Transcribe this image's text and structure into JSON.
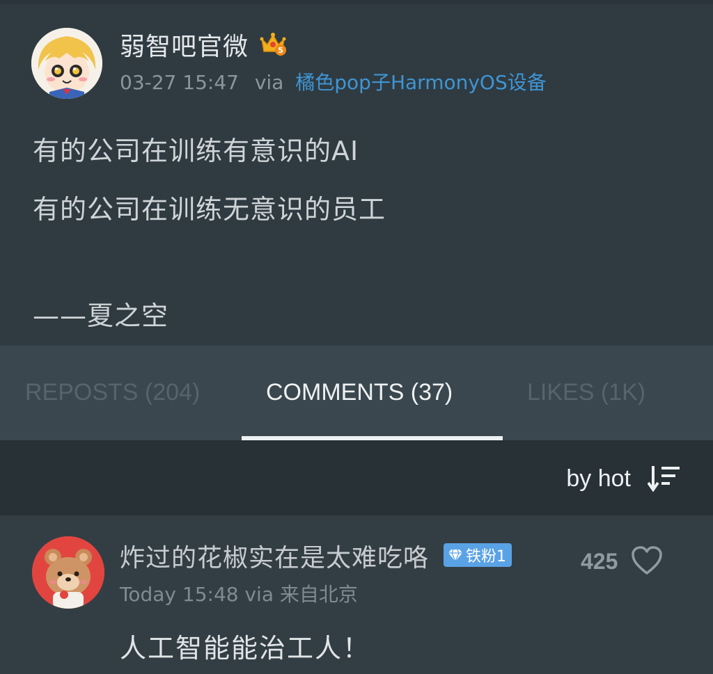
{
  "post": {
    "author": "弱智吧官微",
    "time": "03-27 15:47",
    "via": "via",
    "device": "橘色pop子HarmonyOS设备",
    "lines": [
      "有的公司在训练有意识的AI",
      "有的公司在训练无意识的员工",
      "——夏之空"
    ]
  },
  "tabs": [
    {
      "label": "REPOSTS (204)",
      "active": false
    },
    {
      "label": "COMMENTS (37)",
      "active": true
    },
    {
      "label": "LIKES (1K)",
      "active": false
    }
  ],
  "sort": {
    "label": "by hot",
    "icon": "sort-descending-icon"
  },
  "comments": [
    {
      "author": "炸过的花椒实在是太难吃咯",
      "badge": "铁粉1",
      "likes": "425",
      "time": "Today 15:48",
      "via": "via",
      "location": "来自北京",
      "text": "人工智能能治工人！"
    }
  ],
  "colors": {
    "background": "#333e44",
    "link": "#3f95d4",
    "badge": "#5aa2e6",
    "sortbar": "#273136"
  }
}
